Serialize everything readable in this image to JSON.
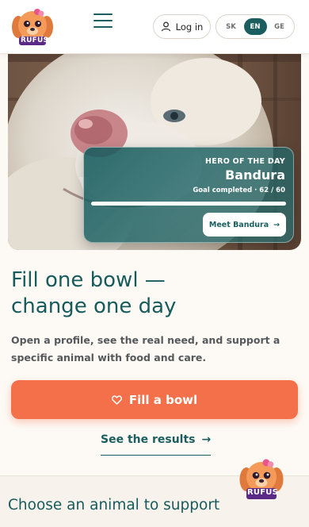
{
  "header": {
    "logo_text": "RUFUS",
    "login_label": "Log in",
    "languages": [
      {
        "code": "SK",
        "active": false
      },
      {
        "code": "EN",
        "active": true
      },
      {
        "code": "GE",
        "active": false
      }
    ]
  },
  "hero": {
    "kicker": "HERO OF THE DAY",
    "name": "Bandura",
    "goal_text": "Goal completed · 62 / 60",
    "goal_progress": 1.0,
    "meet_label": "Meet Bandura",
    "meet_arrow": "→"
  },
  "main": {
    "headline_line1": "Fill one bowl —",
    "headline_line2": "change one day",
    "subcopy": "Open a profile, see the real need, and support a specific animal with food and care.",
    "cta_label": "Fill a bowl",
    "cta_icon": "heart-outline-icon",
    "results_label": "See the results",
    "results_arrow": "→"
  },
  "bottom": {
    "section_title": "Choose an animal to support",
    "mascot_text": "RUFUS"
  },
  "colors": {
    "brand_teal": "#1b5e5f",
    "cta_orange": "#f4704a",
    "mascot_orange": "#f49b5a",
    "mascot_purple": "#5b2a86",
    "mascot_pink": "#e9558a"
  }
}
